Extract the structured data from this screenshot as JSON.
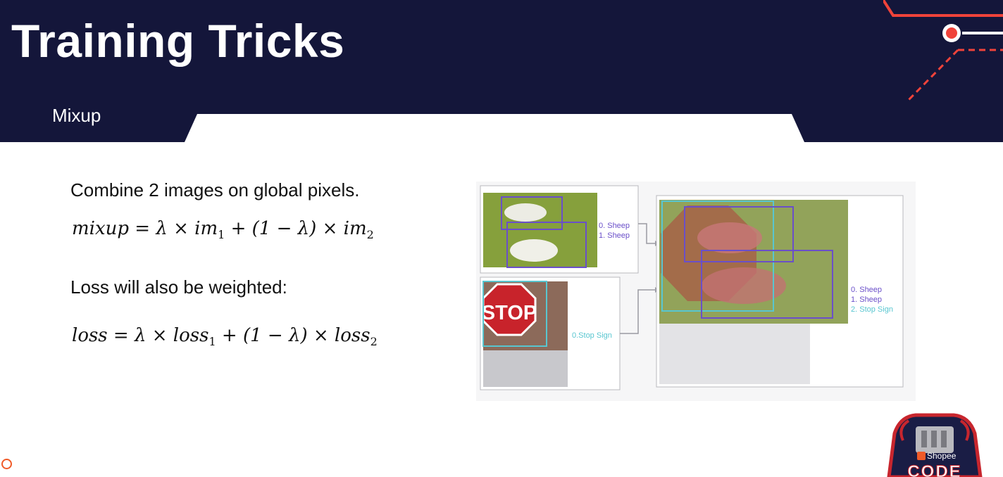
{
  "slide": {
    "title": "Training Tricks",
    "subtitle": "Mixup"
  },
  "content": {
    "bullet_1": "Combine 2 images on global pixels.",
    "formula_1": {
      "lhs": "mixup",
      "op": "=",
      "lambda": "λ",
      "times": "×",
      "term1": "im",
      "sub1": "1",
      "plus": "+",
      "one_minus": "(1 − λ)",
      "term2": "im",
      "sub2": "2"
    },
    "bullet_2": "Loss will also be weighted:",
    "formula_2": {
      "lhs": "loss",
      "op": "=",
      "lambda": "λ",
      "times": "×",
      "term1": "loss",
      "sub1": "1",
      "plus": "+",
      "one_minus": "(1 − λ)",
      "term2": "loss",
      "sub2": "2"
    }
  },
  "figure": {
    "image1_labels": [
      "0. Sheep",
      "1. Sheep"
    ],
    "image2_labels": [
      "0.Stop Sign"
    ],
    "stop_text": "STOP",
    "mixed_labels": [
      "0. Sheep",
      "1. Sheep",
      "2. Stop Sign"
    ]
  },
  "logo": {
    "brand": "Shopee",
    "text": "CODE"
  },
  "colors": {
    "header_bg": "#14163a",
    "accent": "#f0433a",
    "box_purple": "#6a4fc9",
    "box_cyan": "#58c6d0"
  }
}
